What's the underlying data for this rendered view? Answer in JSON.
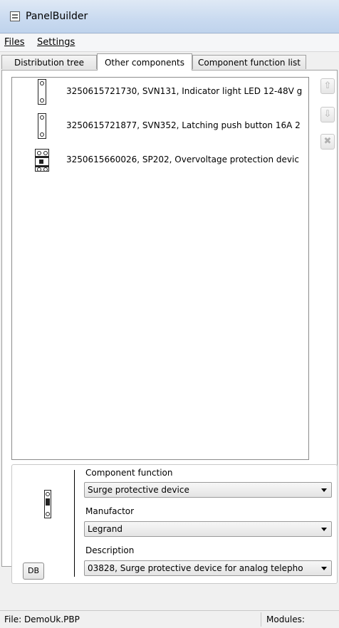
{
  "window": {
    "title": "PanelBuilder"
  },
  "menu": [
    {
      "label": "Files"
    },
    {
      "label": "Settings"
    }
  ],
  "tabs": [
    {
      "label": "Distribution tree",
      "active": false
    },
    {
      "label": "Other components",
      "active": true
    },
    {
      "label": "Component function list",
      "active": false
    }
  ],
  "components": [
    {
      "label": "3250615721730, SVN131, Indicator light LED 12-48V g",
      "icon": "indicator-light-symbol"
    },
    {
      "label": "3250615721877, SVN352, Latching push button 16A 2",
      "icon": "push-button-symbol"
    },
    {
      "label": "3250615660026, SP202, Overvoltage protection devic",
      "icon": "overvoltage-protection-symbol"
    }
  ],
  "side_buttons": [
    {
      "icon": "arrow-up-icon",
      "glyph": "⇧"
    },
    {
      "icon": "arrow-down-icon",
      "glyph": "⇩"
    },
    {
      "icon": "delete-icon",
      "glyph": "✖"
    }
  ],
  "details": {
    "component_function_label": "Component function",
    "component_function_value": "Surge protective device",
    "manufacturer_label": "Manufactor",
    "manufacturer_value": "Legrand",
    "description_label": "Description",
    "description_value": "03828, Surge protective device for analog telepho",
    "db_button": "DB"
  },
  "status": {
    "file": "File: DemoUk.PBP",
    "modules": "Modules:"
  }
}
